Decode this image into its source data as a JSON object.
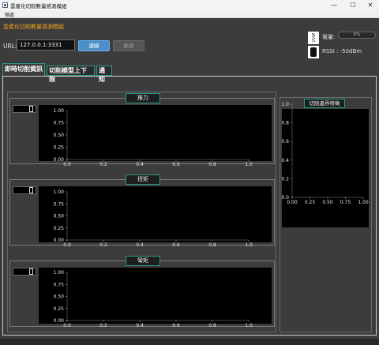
{
  "window": {
    "title": "雲產化切削數量感測模組",
    "minimize_glyph": "—",
    "maximize_glyph": "☐",
    "close_glyph": "✕"
  },
  "menu": {
    "items": [
      "頻道"
    ]
  },
  "app": {
    "subtitle": "雲產化切削數量感測模組"
  },
  "connection": {
    "url_label": "URL:",
    "url_value": "127.0.0.1:3331",
    "connect_label": "連線",
    "disconnect_label": "斷線"
  },
  "status": {
    "battery_label": "電量:",
    "battery_value": "0%",
    "battery_level": 0,
    "rssi_text": "RSSI : -50dBm",
    "icons": [
      "drill-bit-icon",
      "wireless-sensor-icon"
    ]
  },
  "tabs": [
    {
      "label": "即時切削資訊",
      "active": true
    },
    {
      "label": "切削模型上下限",
      "active": false
    },
    {
      "label": "通知",
      "active": false
    }
  ],
  "charts": {
    "groups": [
      {
        "title": "推力"
      },
      {
        "title": "扭矩"
      },
      {
        "title": "彎矩"
      }
    ],
    "side": {
      "title": "切削邊界特徵"
    }
  },
  "chart_data": [
    {
      "type": "line",
      "title": "推力",
      "xlim": [
        0,
        1
      ],
      "ylim": [
        0,
        1
      ],
      "xticks": [
        "0.0",
        "0.2",
        "0.4",
        "0.6",
        "0.8",
        "1.0"
      ],
      "yticks": [
        "0.00",
        "0.25",
        "0.50",
        "0.75",
        "1.00"
      ],
      "series": []
    },
    {
      "type": "line",
      "title": "扭矩",
      "xlim": [
        0,
        1
      ],
      "ylim": [
        0,
        1
      ],
      "xticks": [
        "0.0",
        "0.2",
        "0.4",
        "0.6",
        "0.8",
        "1.0"
      ],
      "yticks": [
        "0.00",
        "0.25",
        "0.50",
        "0.75",
        "1.00"
      ],
      "series": []
    },
    {
      "type": "line",
      "title": "彎矩",
      "xlim": [
        0,
        1
      ],
      "ylim": [
        0,
        1
      ],
      "xticks": [
        "0.0",
        "0.2",
        "0.4",
        "0.6",
        "0.8",
        "1.0"
      ],
      "yticks": [
        "0.00",
        "0.25",
        "0.50",
        "0.75",
        "1.00"
      ],
      "series": []
    },
    {
      "type": "scatter",
      "title": "切削邊界特徵",
      "xlim": [
        0,
        1
      ],
      "ylim": [
        0,
        1
      ],
      "xticks": [
        "0.00",
        "0.25",
        "0.50",
        "0.75",
        "1.00"
      ],
      "yticks": [
        "0.0",
        "0.2",
        "0.4",
        "0.6",
        "0.8",
        "1.0"
      ],
      "series": []
    }
  ]
}
